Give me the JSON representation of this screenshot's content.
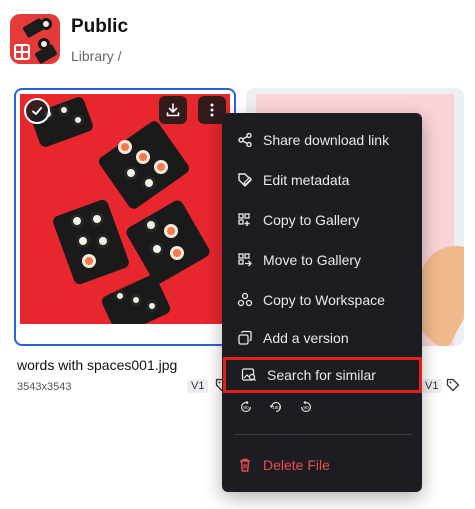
{
  "header": {
    "title": "Public",
    "breadcrumb": "Library /"
  },
  "asset": {
    "file_name": "words with spaces001.jpg",
    "dimensions": "3543x3543",
    "version_badge": "V1"
  },
  "second_asset": {
    "version_badge": "V1"
  },
  "context_menu": {
    "items": [
      {
        "label": "Share download link",
        "icon": "share-icon"
      },
      {
        "label": "Edit metadata",
        "icon": "edit-metadata-icon"
      },
      {
        "label": "Copy to Gallery",
        "icon": "copy-gallery-icon"
      },
      {
        "label": "Move to Gallery",
        "icon": "move-gallery-icon"
      },
      {
        "label": "Copy to Workspace",
        "icon": "copy-workspace-icon"
      },
      {
        "label": "Add a version",
        "icon": "add-version-icon"
      },
      {
        "label": "Search for similar",
        "icon": "image-search-icon"
      }
    ],
    "rotate": [
      "90",
      "180",
      "90"
    ],
    "delete_label": "Delete File"
  },
  "colors": {
    "accent": "#2a60d8",
    "danger": "#ef4c4f",
    "highlight_box": "#e3201b",
    "menu_bg": "#1b1d22"
  }
}
